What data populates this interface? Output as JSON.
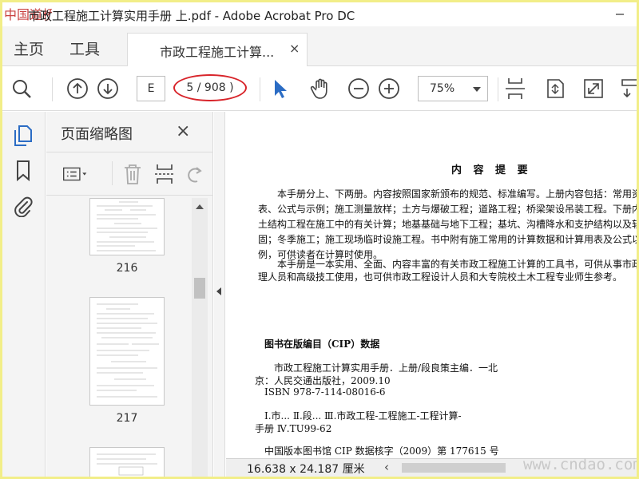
{
  "window": {
    "title": "市政工程施工计算实用手册  上.pdf - Adobe Acrobat Pro DC",
    "logo_text": "中国道桥网"
  },
  "tabs": {
    "home": "主页",
    "tools": "工具",
    "document": "市政工程施工计算...",
    "close": "×"
  },
  "toolbar": {
    "page_input": "E",
    "page_count": "5 / 908 )",
    "zoom": "75%"
  },
  "thumbnails": {
    "title": "页面缩略图",
    "close": "×",
    "pages": [
      "216",
      "217"
    ]
  },
  "document": {
    "heading": "内 容 提 要",
    "summary_lines": [
      "本手册分上、下两册。内容按照国家新颁布的规范、标准编写。上册内容包括：常用资料",
      "表、公式与示例；施工测量放样；土方与爆破工程；道路工程；桥梁架设吊装工程。下册内容包",
      "土结构工程在施工中的有关计算；地基基础与地下工程；基坑、沟槽降水和支护结构以及软土",
      "固；冬季施工；施工现场临时设施工程。书中附有施工常用的计算数据和计算用表及公式以",
      "例，可供读者在计算时使用。",
      "本手册是一本实用、全面、内容丰富的有关市政工程施工计算的工具书，可供从事市政工",
      "理人员和高级技工使用，也可供市政工程设计人员和大专院校土木工程专业师生参考。"
    ],
    "cip_heading": "图书在版编目（CIP）数据",
    "cip_lines": [
      "市政工程施工计算实用手册．上册/段良策主编．一北",
      "京：人民交通出版社，2009.10",
      "ISBN 978-7-114-08016-6",
      "Ⅰ.市...  Ⅱ.段...  Ⅲ.市政工程-工程施工-工程计算-",
      "手册  Ⅳ.TU99-62",
      "中国版本图书馆 CIP 数据核字（2009）第 177615 号"
    ]
  },
  "status": {
    "dimensions": "16.638 x 24.187 厘米",
    "watermark": "www.cndao.com"
  },
  "colors": {
    "accent_blue": "#2b6cc4",
    "highlight_red": "#d8242a",
    "frame_yellow": "#f2ee88"
  }
}
